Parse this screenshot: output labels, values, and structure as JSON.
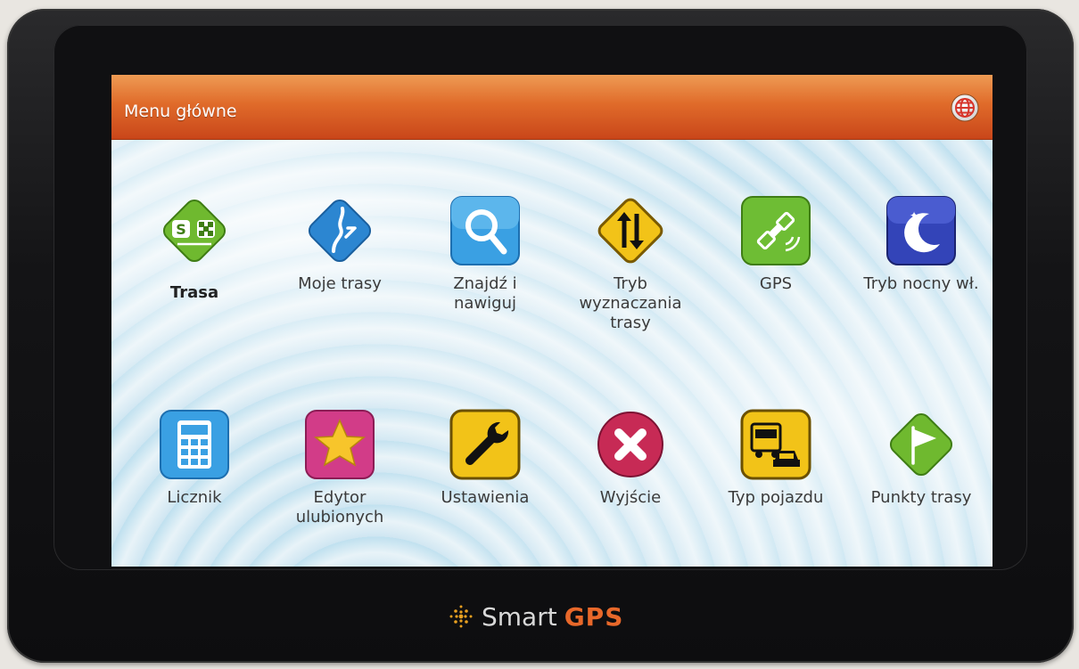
{
  "window": {
    "title": "Menu główne"
  },
  "menu": {
    "row1": [
      {
        "label": "Trasa",
        "icon": "route-icon",
        "bold": true
      },
      {
        "label": "Moje trasy",
        "icon": "my-routes-icon"
      },
      {
        "label": "Znajdź i nawiguj",
        "icon": "search-icon"
      },
      {
        "label": "Tryb wyznaczania trasy",
        "icon": "route-mode-icon"
      },
      {
        "label": "GPS",
        "icon": "satellite-icon"
      },
      {
        "label": "Tryb nocny wł.",
        "icon": "moon-icon"
      }
    ],
    "row2": [
      {
        "label": "Licznik",
        "icon": "calculator-icon"
      },
      {
        "label": "Edytor ulubionych",
        "icon": "star-icon"
      },
      {
        "label": "Ustawienia",
        "icon": "wrench-icon"
      },
      {
        "label": "Wyjście",
        "icon": "exit-icon"
      },
      {
        "label": "Typ pojazdu",
        "icon": "vehicle-icon"
      },
      {
        "label": "Punkty trasy",
        "icon": "flag-icon"
      }
    ]
  },
  "brand": {
    "name": "Smart",
    "suffix": "GPS"
  },
  "colors": {
    "titlebar": "#e06b2a",
    "accent_green": "#6fbf3a",
    "accent_blue": "#2f8fd6"
  }
}
